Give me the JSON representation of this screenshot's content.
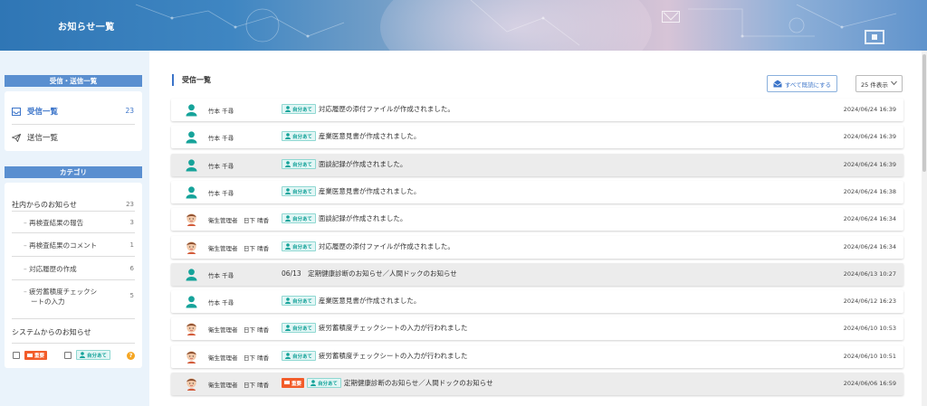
{
  "header": {
    "title": "お知らせ一覧"
  },
  "sidebar": {
    "send_receive_heading": "受信・送信一覧",
    "inbox": {
      "label": "受信一覧",
      "count": "23"
    },
    "sent": {
      "label": "送信一覧"
    },
    "category_heading": "カテゴリ",
    "categories": [
      {
        "label": "社内からのお知らせ",
        "count": "23"
      },
      {
        "label": "再検査結果の報告",
        "count": "3"
      },
      {
        "label": "再検査結果のコメント",
        "count": "1"
      },
      {
        "label": "対応履歴の作成",
        "count": "6"
      },
      {
        "label_line1": "疲労蓄積度チェックシ",
        "label_line2": "ートの入力",
        "count": "5"
      },
      {
        "label": "システムからのお知らせ"
      }
    ],
    "filters": {
      "important_label": "重要",
      "self_label": "自分あて"
    }
  },
  "main": {
    "title": "受信一覧",
    "mark_all_read": "すべて既読にする",
    "per_page": "25 件表示",
    "messages": [
      {
        "sender": "竹本 千尋",
        "self": "自分あて",
        "text": "対応履歴の添付ファイルが作成されました。",
        "date": "2024/06/24 16:39",
        "read": false,
        "avatar": "generic"
      },
      {
        "sender": "竹本 千尋",
        "self": "自分あて",
        "text": "産業医意見書が作成されました。",
        "date": "2024/06/24 16:39",
        "read": false,
        "avatar": "generic"
      },
      {
        "sender": "竹本 千尋",
        "self": "自分あて",
        "text": "面談記録が作成されました。",
        "date": "2024/06/24 16:39",
        "read": true,
        "avatar": "generic"
      },
      {
        "sender": "竹本 千尋",
        "self": "自分あて",
        "text": "産業医意見書が作成されました。",
        "date": "2024/06/24 16:38",
        "read": false,
        "avatar": "generic"
      },
      {
        "sender": "衛生管理者　日下 晴香",
        "self": "自分あて",
        "text": "面談記録が作成されました。",
        "date": "2024/06/24 16:34",
        "read": false,
        "avatar": "person"
      },
      {
        "sender": "衛生管理者　日下 晴香",
        "self": "自分あて",
        "text": "対応履歴の添付ファイルが作成されました。",
        "date": "2024/06/24 16:34",
        "read": false,
        "avatar": "person"
      },
      {
        "sender": "竹本 千尋",
        "text": "06/13　定期健康診断のお知らせ／人間ドックのお知らせ",
        "date": "2024/06/13 10:27",
        "read": true,
        "avatar": "generic"
      },
      {
        "sender": "竹本 千尋",
        "self": "自分あて",
        "text": "産業医意見書が作成されました。",
        "date": "2024/06/12 16:23",
        "read": false,
        "avatar": "generic"
      },
      {
        "sender": "衛生管理者　日下 晴香",
        "self": "自分あて",
        "text": "疲労蓄積度チェックシートの入力が行われました",
        "date": "2024/06/10 10:53",
        "read": false,
        "avatar": "person"
      },
      {
        "sender": "衛生管理者　日下 晴香",
        "self": "自分あて",
        "text": "疲労蓄積度チェックシートの入力が行われました",
        "date": "2024/06/10 10:51",
        "read": false,
        "avatar": "person"
      },
      {
        "sender": "衛生管理者　日下 晴香",
        "important": "重要",
        "self": "自分あて",
        "text": "定期健康診断のお知らせ／人間ドックのお知らせ",
        "date": "2024/06/06 16:59",
        "read": true,
        "avatar": "person"
      }
    ]
  },
  "colors": {
    "accent": "#3b74c9",
    "section_head": "#5a8fd0",
    "self_badge": "#16a39a",
    "important_badge": "#f25c2a"
  }
}
